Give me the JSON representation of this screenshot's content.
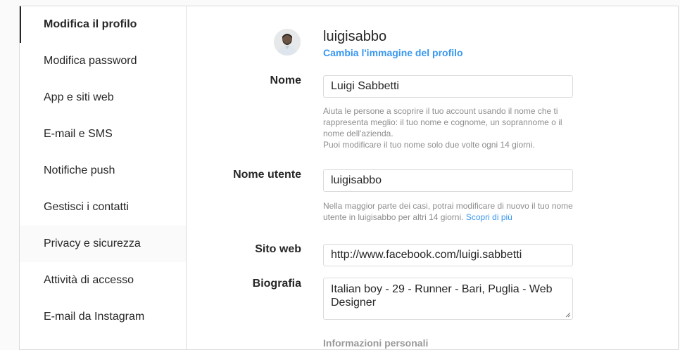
{
  "sidebar": {
    "items": [
      {
        "label": "Modifica il profilo"
      },
      {
        "label": "Modifica password"
      },
      {
        "label": "App e siti web"
      },
      {
        "label": "E-mail e SMS"
      },
      {
        "label": "Notifiche push"
      },
      {
        "label": "Gestisci i contatti"
      },
      {
        "label": "Privacy e sicurezza"
      },
      {
        "label": "Attività di accesso"
      },
      {
        "label": "E-mail da Instagram"
      }
    ]
  },
  "profile": {
    "username": "luigisabbo",
    "change_photo": "Cambia l'immagine del profilo"
  },
  "form": {
    "name": {
      "label": "Nome",
      "value": "Luigi Sabbetti",
      "help1": "Aiuta le persone a scoprire il tuo account usando il nome che ti rappresenta meglio: il tuo nome e cognome, un soprannome o il nome dell'azienda.",
      "help2": "Puoi modificare il tuo nome solo due volte ogni 14 giorni."
    },
    "username": {
      "label": "Nome utente",
      "value": "luigisabbo",
      "help": "Nella maggior parte dei casi, potrai modificare di nuovo il tuo nome utente in luigisabbo per altri 14 giorni.",
      "link": "Scopri di più"
    },
    "website": {
      "label": "Sito web",
      "value": "http://www.facebook.com/luigi.sabbetti"
    },
    "bio": {
      "label": "Biografia",
      "value": "Italian boy - 29 - Runner - Bari, Puglia - Web Designer"
    },
    "personal_info_heading": "Informazioni personali"
  }
}
